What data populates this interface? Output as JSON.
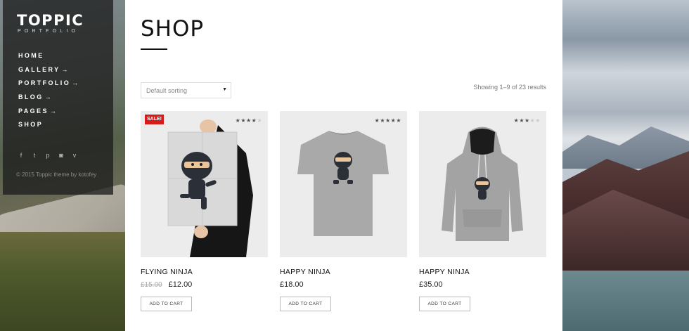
{
  "site": {
    "logo_main": "TOPPIC",
    "logo_sub": "PORTFOLIO"
  },
  "nav": {
    "items": [
      {
        "label": "HOME",
        "has_submenu": false
      },
      {
        "label": "GALLERY",
        "has_submenu": true
      },
      {
        "label": "PORTFOLIO",
        "has_submenu": true
      },
      {
        "label": "BLOG",
        "has_submenu": true
      },
      {
        "label": "PAGES",
        "has_submenu": true
      },
      {
        "label": "SHOP",
        "has_submenu": false
      }
    ],
    "submenu_arrow": "→"
  },
  "social": {
    "icons": [
      "facebook-icon",
      "twitter-icon",
      "pinterest-icon",
      "instagram-icon",
      "vimeo-icon"
    ],
    "glyphs": [
      "f",
      "t",
      "p",
      "◙",
      "v"
    ]
  },
  "footer": {
    "copyright": "© 2015 Toppic theme by kotofey"
  },
  "page": {
    "title": "SHOP",
    "sort_selected": "Default sorting",
    "result_count": "Showing 1–9 of 23 results"
  },
  "products": [
    {
      "name": "FLYING NINJA",
      "old_price": "£15.00",
      "price": "£12.00",
      "rating": 4,
      "sale_badge": "SALE!",
      "button": "ADD TO CART"
    },
    {
      "name": "HAPPY NINJA",
      "price": "£18.00",
      "rating": 5,
      "button": "ADD TO CART"
    },
    {
      "name": "HAPPY NINJA",
      "price": "£35.00",
      "rating": 3,
      "button": "ADD TO CART"
    }
  ],
  "colors": {
    "sale": "#d71a1a",
    "accent": "#111111"
  }
}
